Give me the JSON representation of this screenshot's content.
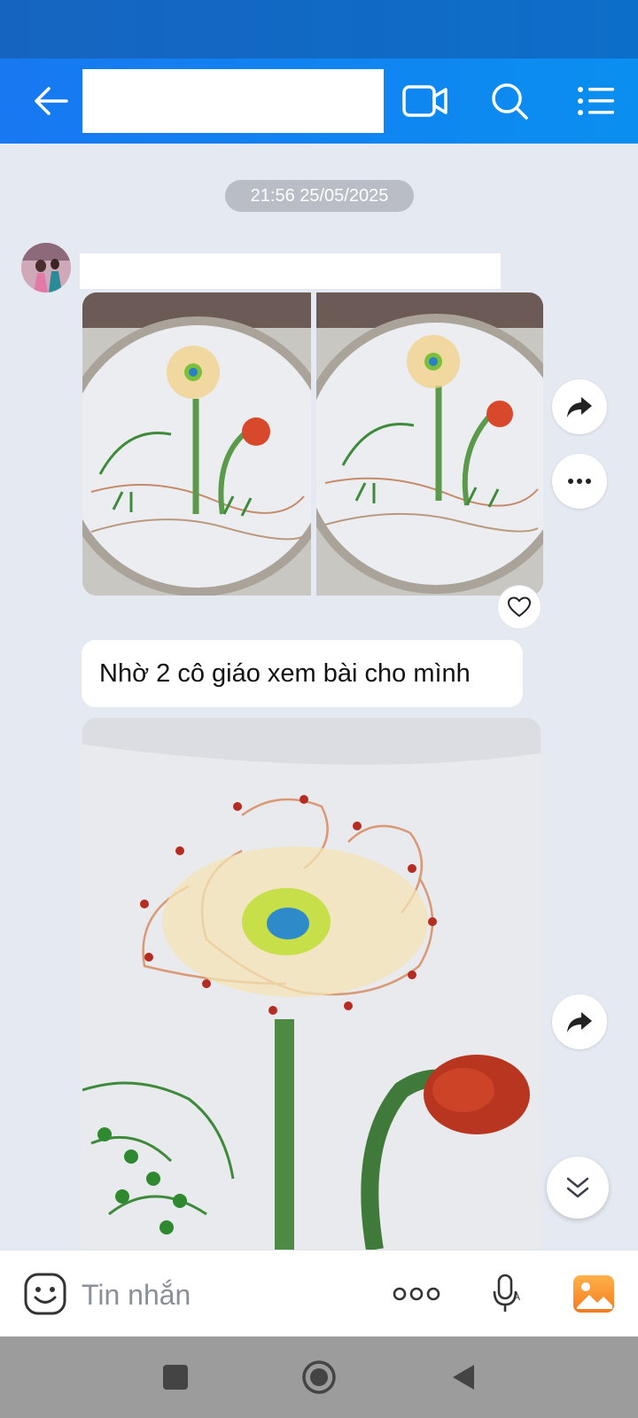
{
  "header": {
    "back_icon": "arrow-left-icon",
    "video_icon": "video-call-icon",
    "search_icon": "search-icon",
    "menu_icon": "list-menu-icon",
    "accent": "#1778f2"
  },
  "conversation": {
    "timestamp": "21:56 25/05/2025",
    "messages": [
      {
        "type": "image-group",
        "images": 2,
        "actions": [
          "share-icon",
          "more-icon"
        ],
        "reaction": "heart-icon"
      },
      {
        "type": "text",
        "text": "Nhờ 2 cô giáo xem bài cho mình"
      },
      {
        "type": "image",
        "actions": [
          "share-icon"
        ]
      }
    ]
  },
  "composer": {
    "placeholder": "Tin nhắn",
    "emoji_icon": "emoji-icon",
    "more_icon": "more-dots-icon",
    "mic_icon": "microphone-icon",
    "gallery_icon": "gallery-icon"
  },
  "nav": {
    "recent_icon": "square-icon",
    "home_icon": "circle-icon",
    "back_icon": "triangle-back-icon"
  }
}
